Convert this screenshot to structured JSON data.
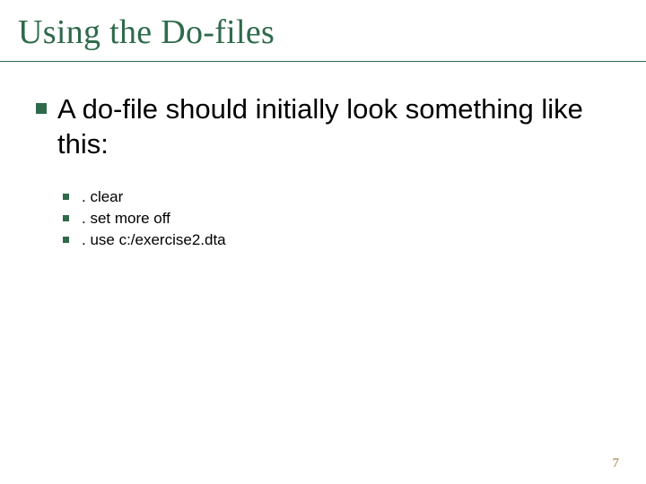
{
  "slide": {
    "title": "Using the Do-files",
    "main_point": "A do-file should initially look something like this:",
    "sub_points": [
      ". clear",
      ". set more off",
      ". use c:/exercise2.dta"
    ],
    "page_number": "7"
  }
}
